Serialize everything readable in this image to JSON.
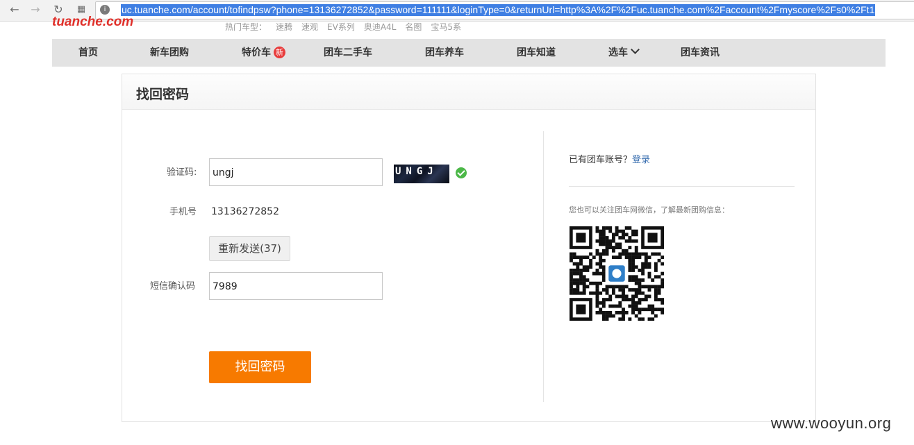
{
  "browser": {
    "url": "uc.tuanche.com/account/tofindpsw?phone=13136272852&password=111111&loginType=0&returnUrl=http%3A%2F%2Fuc.tuanche.com%2Faccount%2Fmyscore%2Fs0%2Ft1"
  },
  "header": {
    "logo_text": "tuanche.com",
    "hot_models": [
      "热门车型：",
      "速腾",
      "速观",
      "EV系列",
      "奥迪A4L",
      "名图",
      "宝马5系"
    ]
  },
  "nav": {
    "items": [
      "首页",
      "新车团购",
      "特价车",
      "团车二手车",
      "团车养车",
      "团车知道",
      "选车",
      "团车资讯"
    ],
    "new_badge": "新"
  },
  "form": {
    "title": "找回密码",
    "captcha_label": "验证码:",
    "captcha_value": "ungj",
    "captcha_image_text": "UNGJ",
    "phone_label": "手机号",
    "phone_value": "13136272852",
    "resend_label": "重新发送(37)",
    "sms_label": "短信确认码",
    "sms_value": "7989",
    "submit_label": "找回密码"
  },
  "sidebar": {
    "has_account_text": "已有团车账号？",
    "login_link": "登录",
    "follow_text": "您也可以关注团车网微信，了解最新团购信息："
  },
  "watermark": "www.wooyun.org",
  "colors": {
    "accent": "#f77a00",
    "link": "#3a6fb0",
    "badge": "#e83c3c",
    "success": "#4cb848",
    "url_highlight": "#3f7fe3"
  }
}
